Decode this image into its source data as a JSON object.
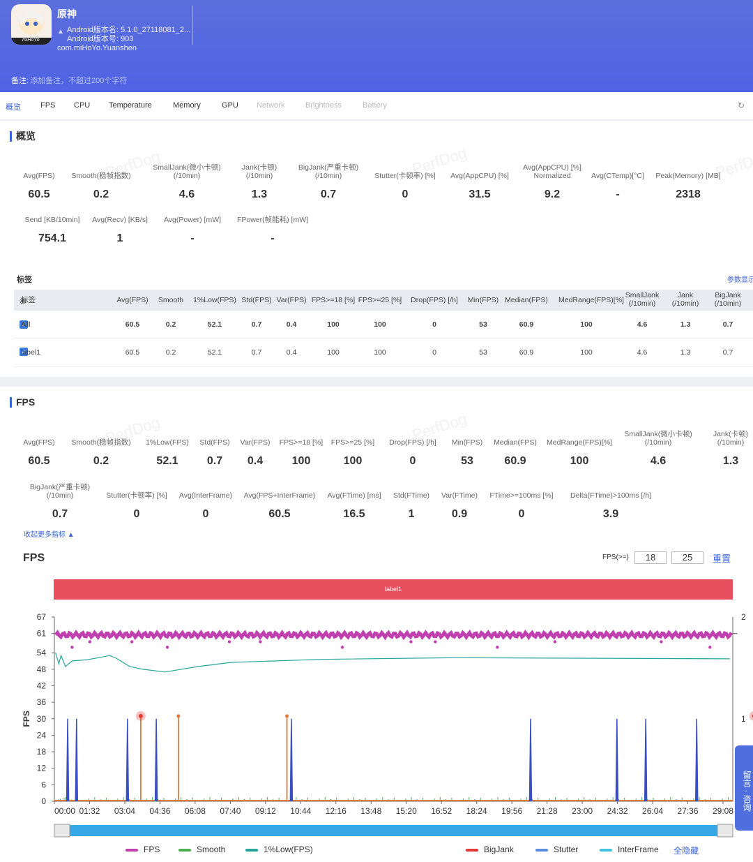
{
  "app": {
    "name": "原神",
    "version_name": "Android版本名: 5.1.0_27118081_2...",
    "version_code": "Android版本号: 903",
    "package": "com.miHoYo.Yuanshen",
    "icon_text": "miHoYo"
  },
  "note": {
    "label": "备注:",
    "placeholder": "添加备注，不超过200个字符"
  },
  "tabs": [
    "概览",
    "FPS",
    "CPU",
    "Temperature",
    "Memory",
    "GPU",
    "Network",
    "Brightness",
    "Battery"
  ],
  "overview": {
    "title": "概览",
    "row1": [
      {
        "label": "Avg(FPS)",
        "value": "60.5"
      },
      {
        "label": "Smooth(稳帧指数)",
        "value": "0.2"
      },
      {
        "label": "SmallJank(微小卡顿)\n(/10min)",
        "value": "4.6"
      },
      {
        "label": "Jank(卡顿)\n(/10min)",
        "value": "1.3"
      },
      {
        "label": "BigJank(严重卡顿)\n(/10min)",
        "value": "0.7"
      },
      {
        "label": "Stutter(卡顿率) [%]",
        "value": "0"
      },
      {
        "label": "Avg(AppCPU) [%]",
        "value": "31.5"
      },
      {
        "label": "Avg(AppCPU) [%]\nNormalized",
        "value": "9.2"
      },
      {
        "label": "Avg(CTemp)[°C]",
        "value": "-"
      },
      {
        "label": "Peak(Memory) [MB]",
        "value": "2318"
      }
    ],
    "row2": [
      {
        "label": "Send [KB/10min]",
        "value": "754.1"
      },
      {
        "label": "Avg(Recv) [KB/s]",
        "value": "1"
      },
      {
        "label": "Avg(Power) [mW]",
        "value": "-"
      },
      {
        "label": "FPower(帧能耗) [mW]",
        "value": "-"
      }
    ]
  },
  "labels_table": {
    "title": "标签",
    "param_link": "参数显示",
    "headers": [
      "标签",
      "Avg(FPS)",
      "Smooth",
      "1%Low(FPS)",
      "Std(FPS)",
      "Var(FPS)",
      "FPS>=18 [%]",
      "FPS>=25 [%]",
      "Drop(FPS) [/h]",
      "Min(FPS)",
      "Median(FPS)",
      "MedRange(FPS)[%]",
      "SmallJank\n(/10min)",
      "Jank\n(/10min)",
      "BigJank\n(/10min)"
    ],
    "rows": [
      [
        "All",
        "60.5",
        "0.2",
        "52.1",
        "0.7",
        "0.4",
        "100",
        "100",
        "0",
        "53",
        "60.9",
        "100",
        "4.6",
        "1.3",
        "0.7"
      ],
      [
        "label1",
        "60.5",
        "0.2",
        "52.1",
        "0.7",
        "0.4",
        "100",
        "100",
        "0",
        "53",
        "60.9",
        "100",
        "4.6",
        "1.3",
        "0.7"
      ]
    ]
  },
  "fps_section": {
    "title": "FPS",
    "row1": [
      {
        "label": "Avg(FPS)",
        "value": "60.5"
      },
      {
        "label": "Smooth(稳帧指数)",
        "value": "0.2"
      },
      {
        "label": "1%Low(FPS)",
        "value": "52.1"
      },
      {
        "label": "Std(FPS)",
        "value": "0.7"
      },
      {
        "label": "Var(FPS)",
        "value": "0.4"
      },
      {
        "label": "FPS>=18 [%]",
        "value": "100"
      },
      {
        "label": "FPS>=25 [%]",
        "value": "100"
      },
      {
        "label": "Drop(FPS) [/h]",
        "value": "0"
      },
      {
        "label": "Min(FPS)",
        "value": "53"
      },
      {
        "label": "Median(FPS)",
        "value": "60.9"
      },
      {
        "label": "MedRange(FPS)[%]",
        "value": "100"
      },
      {
        "label": "SmallJank(微小卡顿)\n(/10min)",
        "value": "4.6"
      },
      {
        "label": "Jank(卡顿)\n(/10min)",
        "value": "1.3"
      }
    ],
    "row2": [
      {
        "label": "BigJank(严重卡顿)\n(/10min)",
        "value": "0.7"
      },
      {
        "label": "Stutter(卡顿率) [%]",
        "value": "0"
      },
      {
        "label": "Avg(InterFrame)",
        "value": "0"
      },
      {
        "label": "Avg(FPS+InterFrame)",
        "value": "60.5"
      },
      {
        "label": "Avg(FTime) [ms]",
        "value": "16.5"
      },
      {
        "label": "Std(FTime)",
        "value": "1"
      },
      {
        "label": "Var(FTime)",
        "value": "0.9"
      },
      {
        "label": "FTime>=100ms [%]",
        "value": "0"
      },
      {
        "label": "Delta(FTime)>100ms [/h]",
        "value": "3.9"
      }
    ],
    "collapse_link": "收起更多指标"
  },
  "chart": {
    "title": "FPS",
    "threshold_label": "FPS(>=)",
    "threshold1": "18",
    "threshold2": "25",
    "reset": "重置",
    "label_band": "label1",
    "ylabel": "FPS",
    "yticks": [
      "67",
      "61",
      "54",
      "48",
      "42",
      "36",
      "30",
      "24",
      "18",
      "12",
      "6",
      "0"
    ],
    "y2ticks": [
      "2",
      "1"
    ],
    "xticks": [
      "00:00",
      "01:32",
      "03:04",
      "04:36",
      "06:08",
      "07:40",
      "09:12",
      "10:44",
      "12:16",
      "13:48",
      "15:20",
      "16:52",
      "18:24",
      "19:56",
      "21:28",
      "23:00",
      "24:32",
      "26:04",
      "27:36",
      "29:08"
    ],
    "legend": [
      "FPS",
      "Smooth",
      "1%Low(FPS)",
      "BigJank",
      "Stutter",
      "InterFrame"
    ],
    "legend_colors": [
      "#c040b0",
      "#4caf50",
      "#26a69a",
      "#e53935",
      "#5b8de0",
      "#40c4e0"
    ],
    "hide_all": "全隐藏",
    "side_button": "留言 · 咨询"
  },
  "chart_data": {
    "type": "line",
    "title": "FPS",
    "xlabel": "",
    "ylabel": "FPS",
    "ylim": [
      0,
      67
    ],
    "x_range": [
      "00:00",
      "29:08"
    ],
    "series": [
      {
        "name": "FPS",
        "approx_level": 60.5,
        "min": 53
      },
      {
        "name": "1%Low(FPS)",
        "start": 54,
        "dip": 47,
        "end": 52
      },
      {
        "name": "Jank",
        "x_minutes": [
          0.6,
          1.0,
          3.3,
          4.6,
          10.7,
          21.5,
          25.4,
          26.7,
          29.0
        ]
      },
      {
        "name": "BigJank",
        "x_minutes": [
          3.9,
          5.6,
          10.5,
          31.6
        ]
      }
    ]
  }
}
